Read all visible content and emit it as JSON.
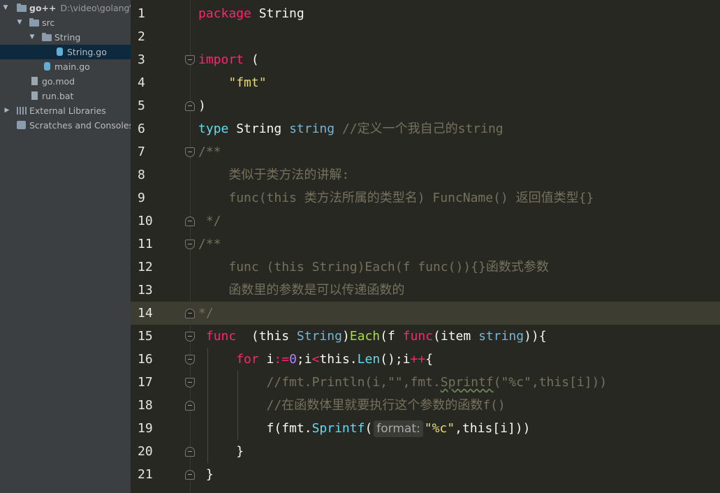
{
  "project_tree": {
    "root": {
      "name": "go++",
      "path": "D:\\video\\golang\\g"
    },
    "items": [
      {
        "label": "src"
      },
      {
        "label": "String"
      },
      {
        "label": "String.go"
      },
      {
        "label": "main.go"
      },
      {
        "label": "go.mod"
      },
      {
        "label": "run.bat"
      },
      {
        "label": "External Libraries"
      },
      {
        "label": "Scratches and Consoles"
      }
    ]
  },
  "editor": {
    "current_line": 14,
    "line_numbers": [
      "1",
      "2",
      "3",
      "4",
      "5",
      "6",
      "7",
      "8",
      "9",
      "10",
      "11",
      "12",
      "13",
      "14",
      "15",
      "16",
      "17",
      "18",
      "19",
      "20",
      "21"
    ],
    "lines": {
      "l1": {
        "kw": "package",
        "name": "String"
      },
      "l3": {
        "kw": "import",
        "paren": "("
      },
      "l4": {
        "str": "\"fmt\""
      },
      "l5": {
        "paren": ")"
      },
      "l6": {
        "kw": "type",
        "name": "String",
        "type": "string",
        "comment": "//定义一个我自己的string"
      },
      "l7": {
        "comment": "/**"
      },
      "l8": {
        "comment": "类似于类方法的讲解:"
      },
      "l9": {
        "comment": "func(this 类方法所属的类型名) FuncName() 返回值类型{}"
      },
      "l10": {
        "comment": "*/"
      },
      "l11": {
        "comment": "/**"
      },
      "l12": {
        "comment": "func (this String)Each(f func()){}函数式参数"
      },
      "l13": {
        "comment": "函数里的参数是可以传递函数的"
      },
      "l14": {
        "comment": "*/"
      },
      "l15": {
        "kw": "func",
        "p1": "(this ",
        "type": "String",
        "p2": ")",
        "fn": "Each",
        "p3": "(f ",
        "kw2": "func",
        "p4": "(item ",
        "type2": "string",
        "p5": ")){"
      },
      "l16": {
        "kw": "for",
        "v1": " i",
        "op1": ":=",
        "num": "0",
        "p1": ";i",
        "op2": "<",
        "p2": "this.",
        "meth": "Len",
        "p3": "();i",
        "op3": "++",
        "p4": "{"
      },
      "l17": {
        "comment_a": "//fmt.Println(i,\"\",fmt.",
        "comment_sq": "Sprintf",
        "comment_b": "(\"%c\",this[i]))"
      },
      "l18": {
        "comment": "//在函数体里就要执行这个参数的函数f()"
      },
      "l19": {
        "p1": "f(fmt.",
        "meth": "Sprintf",
        "p2": "(",
        "hint": "format:",
        "str": "\"%c\"",
        "p3": ",this[i]))"
      },
      "l20": {
        "p": "}"
      },
      "l21": {
        "p": "}"
      }
    }
  }
}
